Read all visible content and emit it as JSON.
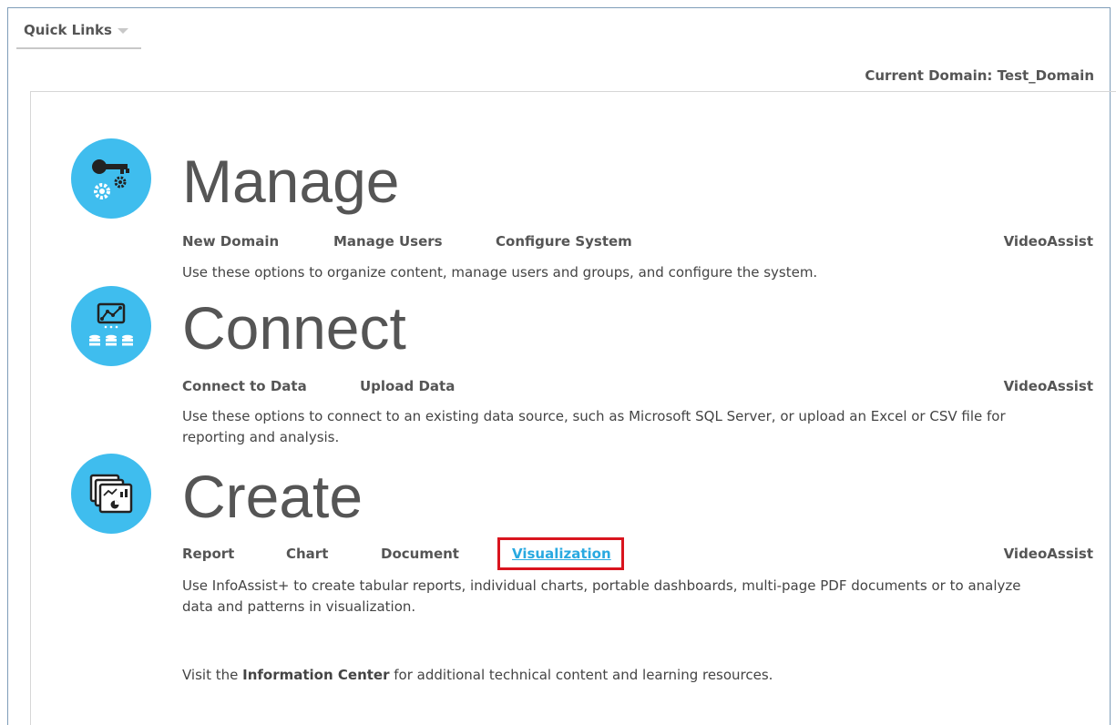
{
  "quick_links": {
    "label": "Quick Links"
  },
  "current_domain": "Current Domain: Test_Domain",
  "sections": {
    "manage": {
      "title": "Manage",
      "links": [
        "New Domain",
        "Manage Users",
        "Configure System"
      ],
      "videoassist": "VideoAssist",
      "description": "Use these options to organize content, manage users and groups, and configure the system."
    },
    "connect": {
      "title": "Connect",
      "links": [
        "Connect to Data",
        "Upload Data"
      ],
      "videoassist": "VideoAssist",
      "description": "Use these options to connect to an existing data source, such as Microsoft SQL Server, or upload an Excel or CSV file for reporting and analysis."
    },
    "create": {
      "title": "Create",
      "links": [
        "Report",
        "Chart",
        "Document",
        "Visualization"
      ],
      "videoassist": "VideoAssist",
      "description": "Use InfoAssist+ to create tabular reports, individual charts, portable dashboards, multi-page PDF documents or to analyze data and patterns in visualization."
    }
  },
  "info": {
    "prefix": "Visit the ",
    "link": "Information Center",
    "suffix": " for additional technical content and learning resources."
  },
  "colors": {
    "accent": "#3fbdee",
    "link_active": "#29a9e0",
    "highlight_box": "#d9141e"
  }
}
